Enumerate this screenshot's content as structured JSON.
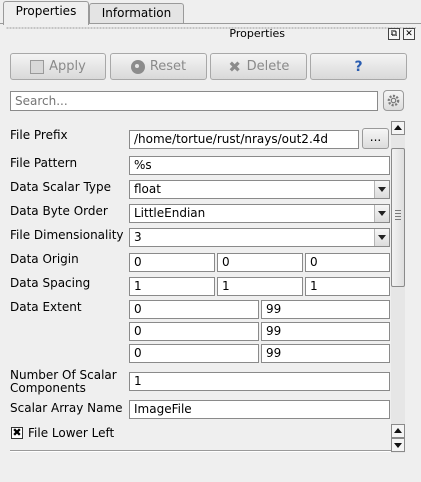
{
  "tabs": [
    {
      "label": "Properties",
      "active": true
    },
    {
      "label": "Information",
      "active": false
    }
  ],
  "panel": {
    "title": "Properties",
    "float_icon": "float-icon",
    "close_icon": "close-icon"
  },
  "toolbar": {
    "apply": {
      "label": "Apply",
      "icon": "apply-icon",
      "enabled": false
    },
    "reset": {
      "label": "Reset",
      "icon": "reset-icon",
      "enabled": false
    },
    "delete": {
      "label": "Delete",
      "icon": "delete-icon",
      "enabled": false
    },
    "help": {
      "label": "?",
      "icon": "help-icon"
    }
  },
  "search": {
    "placeholder": "Search...",
    "value": "",
    "settings_icon": "gear-icon"
  },
  "properties": {
    "file_prefix": {
      "label": "File Prefix",
      "value": "/home/tortue/rust/nrays/out2.4d",
      "browse_label": "..."
    },
    "file_pattern": {
      "label": "File Pattern",
      "value": "%s"
    },
    "data_scalar_type": {
      "label": "Data Scalar Type",
      "value": "float"
    },
    "data_byte_order": {
      "label": "Data Byte Order",
      "value": "LittleEndian"
    },
    "file_dimensionality": {
      "label": "File Dimensionality",
      "value": "3"
    },
    "data_origin": {
      "label": "Data Origin",
      "values": [
        "0",
        "0",
        "0"
      ]
    },
    "data_spacing": {
      "label": "Data Spacing",
      "values": [
        "1",
        "1",
        "1"
      ]
    },
    "data_extent": {
      "label": "Data Extent",
      "rows": [
        [
          "0",
          "99"
        ],
        [
          "0",
          "99"
        ],
        [
          "0",
          "99"
        ]
      ]
    },
    "number_of_scalar_components": {
      "label_line1": "Number Of Scalar",
      "label_line2": "Components",
      "value": "1"
    },
    "scalar_array_name": {
      "label": "Scalar Array Name",
      "value": "ImageFile"
    },
    "file_lower_left": {
      "label": "File Lower Left",
      "checked": true,
      "check_mark": "✖"
    }
  },
  "colors": {
    "accent": "#2a5db0",
    "background": "#efefef"
  }
}
